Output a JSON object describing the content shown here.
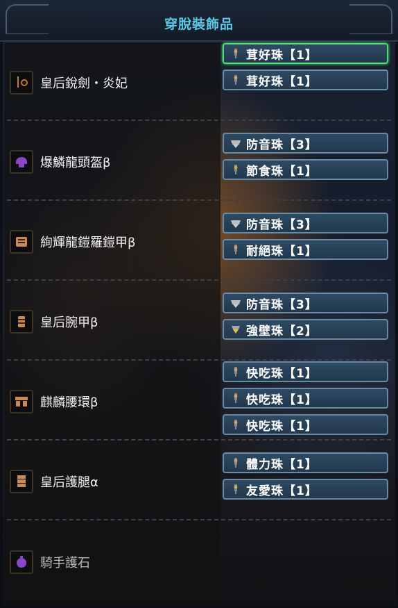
{
  "header": {
    "title": "穿脫裝飾品"
  },
  "equipment": [
    {
      "name": "皇后銳劍・炎妃",
      "icon": "weapon-sword-icon",
      "icon_color": "#c07a3c",
      "slots": [
        {
          "name": "茸好珠",
          "bracket_open": "【",
          "level": "1",
          "bracket_close": "】",
          "icon": "decoration-lv1-icon",
          "active": true
        },
        {
          "name": "茸好珠",
          "bracket_open": "【",
          "level": "1",
          "bracket_close": "】",
          "icon": "decoration-lv1-icon",
          "active": false
        }
      ]
    },
    {
      "name": "爆鱗龍頭盔β",
      "icon": "helmet-icon",
      "icon_color": "#8a48c8",
      "slots": [
        {
          "name": "防音珠",
          "bracket_open": "【",
          "level": "3",
          "bracket_close": "】",
          "icon": "decoration-lv3-icon",
          "active": false
        },
        {
          "name": "節食珠",
          "bracket_open": "【",
          "level": "1",
          "bracket_close": "】",
          "icon": "decoration-lv1-icon",
          "active": false
        }
      ]
    },
    {
      "name": "絢輝龍鎧羅鎧甲β",
      "icon": "chest-armor-icon",
      "icon_color": "#c98a5a",
      "slots": [
        {
          "name": "防音珠",
          "bracket_open": "【",
          "level": "3",
          "bracket_close": "】",
          "icon": "decoration-lv3-icon",
          "active": false
        },
        {
          "name": "耐絕珠",
          "bracket_open": "【",
          "level": "1",
          "bracket_close": "】",
          "icon": "decoration-lv1-icon",
          "active": false
        }
      ]
    },
    {
      "name": "皇后腕甲β",
      "icon": "arm-armor-icon",
      "icon_color": "#c98a5a",
      "slots": [
        {
          "name": "防音珠",
          "bracket_open": "【",
          "level": "3",
          "bracket_close": "】",
          "icon": "decoration-lv3-icon",
          "active": false
        },
        {
          "name": "強壁珠",
          "bracket_open": "【",
          "level": "2",
          "bracket_close": "】",
          "icon": "decoration-lv2-icon",
          "active": false
        }
      ]
    },
    {
      "name": "麒麟腰環β",
      "icon": "waist-armor-icon",
      "icon_color": "#c98a5a",
      "slots": [
        {
          "name": "快吃珠",
          "bracket_open": "【",
          "level": "1",
          "bracket_close": "】",
          "icon": "decoration-lv1-icon",
          "active": false
        },
        {
          "name": "快吃珠",
          "bracket_open": "【",
          "level": "1",
          "bracket_close": "】",
          "icon": "decoration-lv1-icon",
          "active": false
        },
        {
          "name": "快吃珠",
          "bracket_open": "【",
          "level": "1",
          "bracket_close": "】",
          "icon": "decoration-lv1-icon",
          "active": false
        }
      ]
    },
    {
      "name": "皇后護腿α",
      "icon": "leg-armor-icon",
      "icon_color": "#c98a5a",
      "slots": [
        {
          "name": "體力珠",
          "bracket_open": "【",
          "level": "1",
          "bracket_close": "】",
          "icon": "decoration-lv1-icon",
          "active": false
        },
        {
          "name": "友愛珠",
          "bracket_open": "【",
          "level": "1",
          "bracket_close": "】",
          "icon": "decoration-lv1-icon",
          "active": false
        }
      ]
    },
    {
      "name": "騎手護石",
      "icon": "charm-icon",
      "icon_color": "#8a48c8",
      "dim": true,
      "slots": []
    }
  ],
  "colors": {
    "title": "#5ec8e8",
    "slot_border": "#6b8aa6",
    "slot_active_border": "#4fe07a",
    "lv1_gem": "#d9a25a",
    "lv2_gem": "#e8c03a",
    "lv3_gem": "#cfcfcf"
  }
}
